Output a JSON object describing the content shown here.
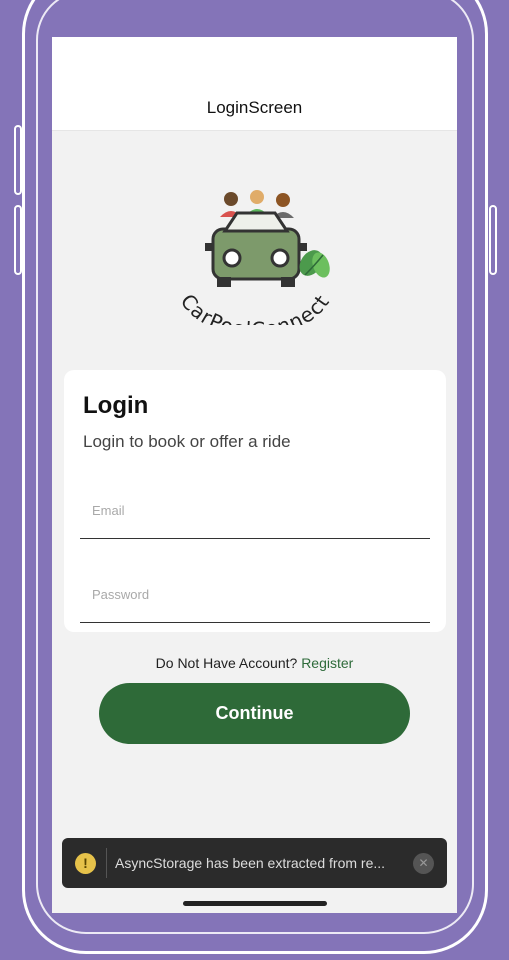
{
  "nav": {
    "title": "LoginScreen"
  },
  "logo": {
    "text": "CarPoolConnect"
  },
  "card": {
    "title": "Login",
    "subtitle": "Login to book or offer a ride",
    "email_placeholder": "Email",
    "password_placeholder": "Password"
  },
  "register": {
    "prompt": "Do Not Have Account?",
    "link": "Register"
  },
  "continue_button": {
    "label": "Continue"
  },
  "toast": {
    "message": "AsyncStorage has been extracted from re...",
    "icon": "warning-icon",
    "close_icon": "close-icon"
  },
  "colors": {
    "accent": "#2e6a38",
    "background": "#8474b8",
    "screen": "#f2f2f2"
  }
}
